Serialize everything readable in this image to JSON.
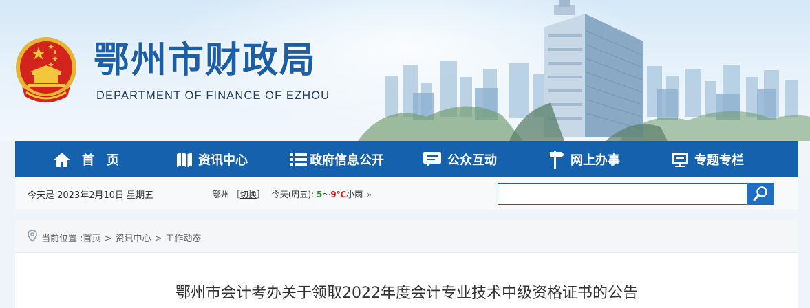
{
  "header": {
    "title": "鄂州市财政局",
    "subtitle": "DEPARTMENT OF FINANCE OF EZHOU"
  },
  "nav": {
    "items": [
      {
        "label": "首　页",
        "icon": "home-icon"
      },
      {
        "label": "资讯中心",
        "icon": "book-icon"
      },
      {
        "label": "政府信息公开",
        "icon": "list-icon"
      },
      {
        "label": "公众互动",
        "icon": "chat-icon"
      },
      {
        "label": "网上办事",
        "icon": "signpost-icon"
      },
      {
        "label": "专题专栏",
        "icon": "monitor-icon"
      }
    ]
  },
  "info": {
    "date": "今天是 2023年2月10日 星期五",
    "city": "鄂州",
    "switch_label": "切换",
    "today_label": "今天(周五):",
    "temp_low": "5",
    "temp_sep": "～",
    "temp_high": "9℃",
    "condition": "小雨",
    "more": "»"
  },
  "search": {
    "placeholder": "",
    "value": ""
  },
  "breadcrumb": {
    "label": "当前位置 :",
    "items": [
      "首页",
      "资讯中心",
      "工作动态"
    ],
    "separator": ">"
  },
  "article": {
    "title": "鄂州市会计考办关于领取2022年度会计专业技术中级资格证书的公告"
  },
  "colors": {
    "nav_bg": "#1661ad",
    "title_blue": "#1b5fa8",
    "temp_low": "#1f9a2b",
    "temp_high": "#d42020"
  }
}
